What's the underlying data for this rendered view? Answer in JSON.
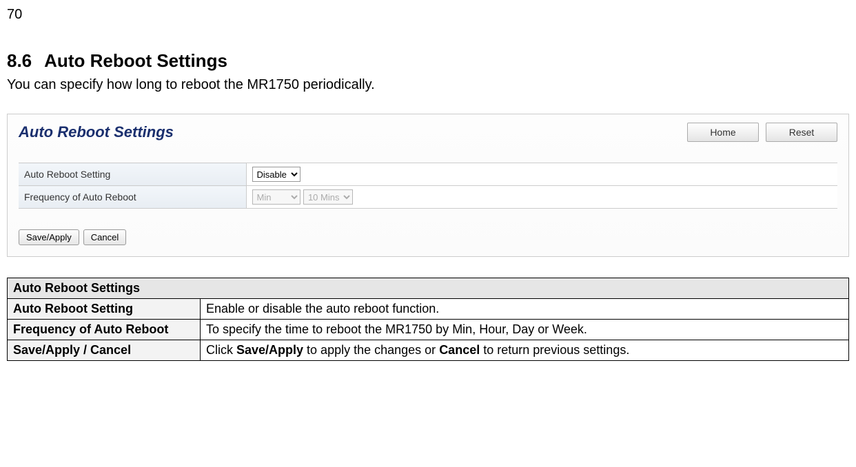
{
  "page_number": "70",
  "heading_number": "8.6",
  "heading_text": "Auto Reboot Settings",
  "intro_text": "You can specify how long to reboot the MR1750 periodically.",
  "panel": {
    "title": "Auto Reboot Settings",
    "home_label": "Home",
    "reset_label": "Reset",
    "row1_label": "Auto Reboot Setting",
    "row1_value": "Disable",
    "row2_label": "Frequency of Auto Reboot",
    "row2_unit": "Min",
    "row2_value": "10 Mins",
    "save_label": "Save/Apply",
    "cancel_label": "Cancel"
  },
  "desc": {
    "header": "Auto Reboot Settings",
    "rows": [
      {
        "label": "Auto Reboot Setting",
        "text": "Enable or disable the auto reboot function."
      },
      {
        "label": "Frequency of Auto Reboot",
        "text": "To specify the time to reboot the MR1750 by Min, Hour, Day or Week."
      },
      {
        "label": "Save/Apply / Cancel",
        "text_prefix": "Click ",
        "strong1": "Save/Apply",
        "middle": " to apply the changes or ",
        "strong2": "Cancel",
        "text_suffix": " to return previous settings."
      }
    ]
  }
}
